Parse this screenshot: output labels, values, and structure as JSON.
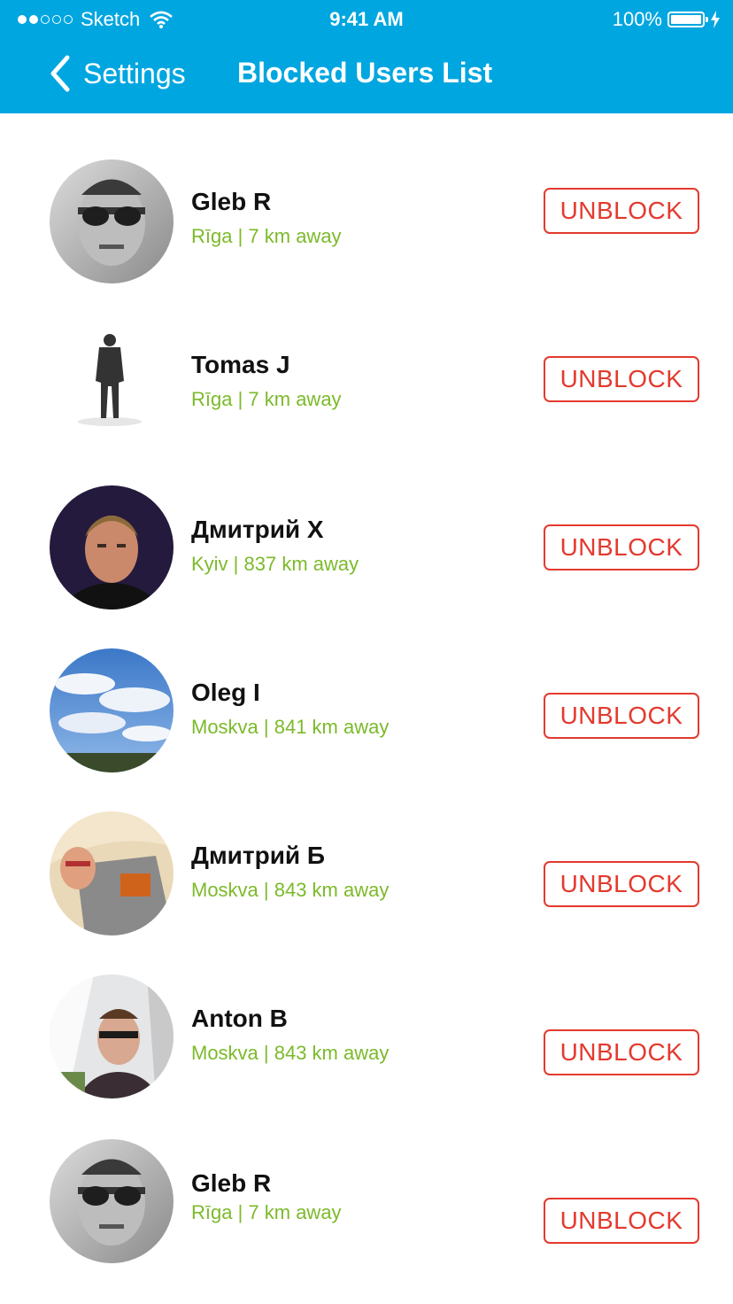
{
  "status_bar": {
    "carrier": "Sketch",
    "time": "9:41 AM",
    "battery": "100%"
  },
  "nav": {
    "back_label": "Settings",
    "title": "Blocked Users List"
  },
  "users": [
    {
      "name": "Gleb R",
      "meta": "Rīga | 7 km away",
      "button": "UNBLOCK"
    },
    {
      "name": "Tomas J",
      "meta": "Rīga | 7 km away",
      "button": "UNBLOCK"
    },
    {
      "name": "Дмитрий Х",
      "meta": "Kyiv | 837 km away",
      "button": "UNBLOCK"
    },
    {
      "name": "Oleg I",
      "meta": "Moskva | 841 km away",
      "button": "UNBLOCK"
    },
    {
      "name": "Дмитрий Б",
      "meta": "Moskva | 843 km away",
      "button": "UNBLOCK"
    },
    {
      "name": "Anton B",
      "meta": "Moskva | 843 km away",
      "button": "UNBLOCK"
    },
    {
      "name": "Gleb R",
      "meta": "Rīga | 7 km away",
      "button": "UNBLOCK"
    }
  ],
  "colors": {
    "header": "#00a6e0",
    "accent_green": "#7cba2a",
    "unblock_red": "#e33a2e"
  }
}
